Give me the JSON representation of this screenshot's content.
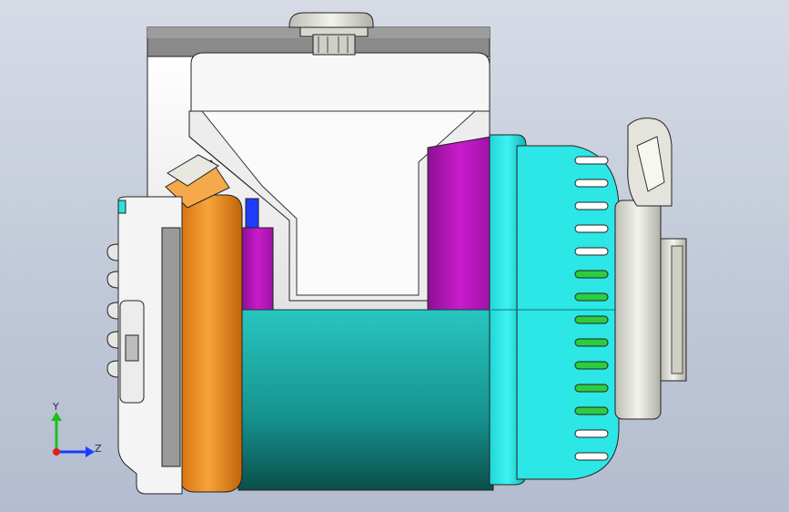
{
  "viewport": {
    "background_top": "#d6dbe6",
    "background_bottom": "#b4bdcf"
  },
  "model": {
    "colors": {
      "housing": "#f2f2f2",
      "housing_shadow": "#c9c9c9",
      "top_plate": "#7d7d7d",
      "cyan_shell": "#22e0e0",
      "cyan_dark": "#0aa8a8",
      "teal_body": "#1aa9a4",
      "teal_dark": "#0d5c58",
      "magenta": "#c012c4",
      "magenta_dark": "#7b0a80",
      "orange": "#f28c1c",
      "orange_dark": "#b85f0a",
      "blue_strip": "#1f3cff",
      "fin_green": "#2ecc40",
      "pulley": "#e6e6e0",
      "outline": "#1a1a1a"
    }
  },
  "triad": {
    "y_label": "Y",
    "z_label": "Z",
    "y_color": "#1dbf1d",
    "z_color": "#1a3dff",
    "x_color": "#e0201c"
  }
}
